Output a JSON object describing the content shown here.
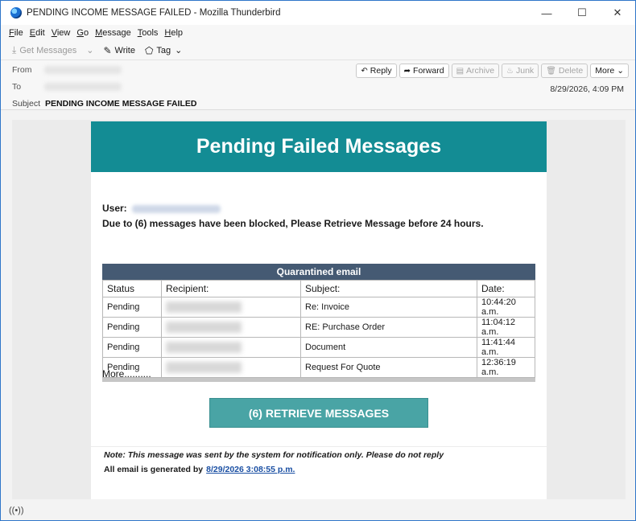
{
  "window": {
    "title": "PENDING INCOME MESSAGE FAILED - Mozilla Thunderbird",
    "minimize": "—",
    "maximize": "☐",
    "close": "✕"
  },
  "menu": [
    {
      "pre": "",
      "key": "F",
      "post": "ile"
    },
    {
      "pre": "",
      "key": "E",
      "post": "dit"
    },
    {
      "pre": "",
      "key": "V",
      "post": "iew"
    },
    {
      "pre": "",
      "key": "G",
      "post": "o"
    },
    {
      "pre": "",
      "key": "M",
      "post": "essage"
    },
    {
      "pre": "",
      "key": "T",
      "post": "ools"
    },
    {
      "pre": "",
      "key": "H",
      "post": "elp"
    }
  ],
  "toolbar": {
    "get_messages": "Get Messages",
    "write": "Write",
    "tag": "Tag"
  },
  "headers": {
    "from_label": "From",
    "to_label": "To",
    "subject_label": "Subject",
    "subject": "PENDING INCOME MESSAGE FAILED",
    "date": "8/29/2026, 4:09 PM"
  },
  "actions": {
    "reply": "Reply",
    "forward": "Forward",
    "archive": "Archive",
    "junk": "Junk",
    "delete": "Delete",
    "more": "More"
  },
  "email": {
    "banner_title": "Pending Failed Messages",
    "user_label": "User:",
    "notice": "Due to (6) messages have been blocked, Please Retrieve Message before 24 hours.",
    "table_title": "Quarantined email",
    "columns": [
      "Status",
      "Recipient:",
      "Subject:",
      "Date:"
    ],
    "rows": [
      {
        "status": "Pending",
        "subject": "Re: Invoice",
        "date": "10:44:20 a.m."
      },
      {
        "status": "Pending",
        "subject": "RE: Purchase Order",
        "date": "11:04:12 a.m."
      },
      {
        "status": "Pending",
        "subject": "Document",
        "date": "11:41:44 a.m."
      },
      {
        "status": "Pending",
        "subject": "Request For Quote",
        "date": "12:36:19 a.m."
      }
    ],
    "more": "More..........",
    "button": "(6) RETRIEVE MESSAGES",
    "note": "Note: This message was sent by the system for notification only. Please do not reply",
    "generated_label": "All email is generated by",
    "generated_link": "8/29/2026 3:08:55 p.m."
  },
  "icons": {
    "app": "thunderbird-icon",
    "get_messages": "download-icon",
    "write": "pencil-icon",
    "tag": "tag-icon",
    "reply": "reply-icon",
    "forward": "forward-icon",
    "archive": "archive-icon",
    "junk": "flame-icon",
    "delete": "trash-icon",
    "status": "wifi-icon"
  },
  "colors": {
    "banner": "#138c94",
    "table_header": "#455a73",
    "button": "#49a4a5",
    "link": "#1a4fa3"
  }
}
